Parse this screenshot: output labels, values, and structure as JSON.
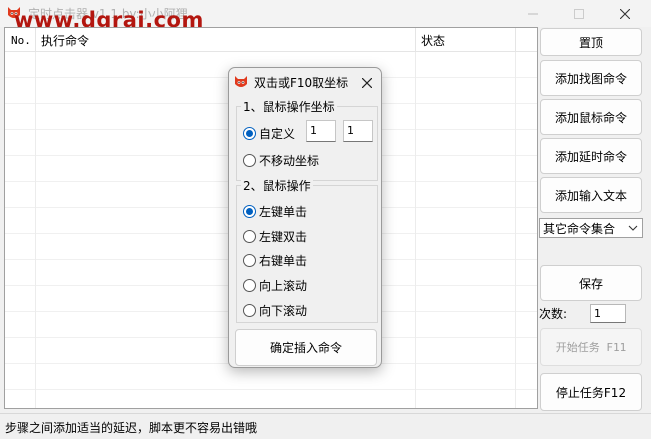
{
  "window": {
    "title": "定时点击器 v1.1 by:小小阿狸",
    "watermark": "www.dgrai.com"
  },
  "list": {
    "columns": [
      "No.",
      "执行命令",
      "状态"
    ]
  },
  "buttons": {
    "pin": "置顶",
    "add_find_image": "添加找图命令",
    "add_mouse": "添加鼠标命令",
    "add_delay": "添加延时命令",
    "add_input_text": "添加输入文本",
    "other_commands": "其它命令集合",
    "save": "保存",
    "count_label": "次数:",
    "count_value": "1",
    "start_task": "开始任务 F11",
    "stop_task": "停止任务F12"
  },
  "status": {
    "text": "步骤之间添加适当的延迟，脚本更不容易出错哦"
  },
  "dialog": {
    "title": "双击或F10取坐标",
    "group1_label": "1、鼠标操作坐标",
    "custom_label": "自定义",
    "x_value": "1",
    "y_value": "1",
    "no_move_label": "不移动坐标",
    "group2_label": "2、鼠标操作",
    "actions": [
      "左键单击",
      "左键双击",
      "右键单击",
      "向上滚动",
      "向下滚动"
    ],
    "selected_action": "左键单击",
    "insert_button": "确定插入命令"
  },
  "colors": {
    "watermark": "#b3160f",
    "radio_selected": "#0060c0"
  }
}
